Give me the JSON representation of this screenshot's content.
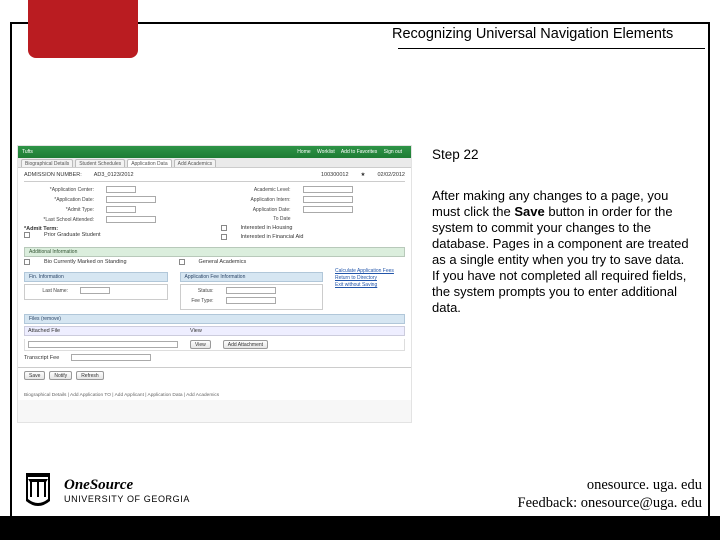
{
  "header": {
    "title": "Recognizing Universal Navigation Elements"
  },
  "step": {
    "label": "Step 22"
  },
  "body": {
    "pre_bold": "After making any changes to a page, you must click the ",
    "bold": "Save",
    "post_bold": " button in order for the system to commit your changes to the database. Pages in a component are treated as a single entity when you try to save data. If you have not completed all required fields, the system prompts you to enter additional data."
  },
  "footer": {
    "site": "onesource. uga. edu",
    "feedback": "Feedback: onesource@uga. edu"
  },
  "branding": {
    "name": "OneSource",
    "org": "UNIVERSITY OF GEORGIA"
  },
  "screenshot": {
    "topbar_left": [
      "Tufts"
    ],
    "topbar_right": [
      "Home",
      "Worklist",
      "Add to Favorites",
      "Sign out"
    ],
    "tabs": [
      "Biographical Details",
      "Student Schedules",
      "Application Data",
      "Add Academics"
    ],
    "info_line": [
      "ADMISSION NUMBER:",
      "AD3_0123/2012",
      "100300012",
      "★",
      "02/02/2012"
    ],
    "section1_label": "*Admit Term:",
    "labels": {
      "app_center": "*Application Center:",
      "app_date": "*Application Date:",
      "admit_type": "*Admit Type:",
      "last_sch": "*Last School Attended:",
      "academic_level": "Academic Level:",
      "application_intern": "Application Intern:",
      "application_dt": "Application Date:",
      "to_date": "To Date"
    },
    "checkboxes": [
      "Prior Graduate Student",
      "Interested in Housing",
      "Interested in Financial Aid"
    ],
    "sections": {
      "add_info": "Additional Information",
      "bio_currently": "Bio Currently Marked on Standing",
      "fin_info": "Fin. Information",
      "app_fee": "Application Fee Information",
      "general_acad": "General Academics",
      "files": "Files (remove)"
    },
    "fields": {
      "last_name": "Last Name:",
      "status": "Status:",
      "fee_type": "Fee Type:"
    },
    "table": {
      "header_attach": "Attached File",
      "header_view": "View",
      "view_btn": "View",
      "add_attach": "Add Attachment"
    },
    "transcript": "Transcript Fee",
    "links": [
      "Calculate Application Fees",
      "Return to Directory",
      "Exit without Saving"
    ],
    "buttons": {
      "save": "Save",
      "notify": "Notify",
      "refresh": "Refresh"
    },
    "footer_links": "Biographical Details | Add Application TO | Add Applicant | Application Data | Add Academics"
  }
}
